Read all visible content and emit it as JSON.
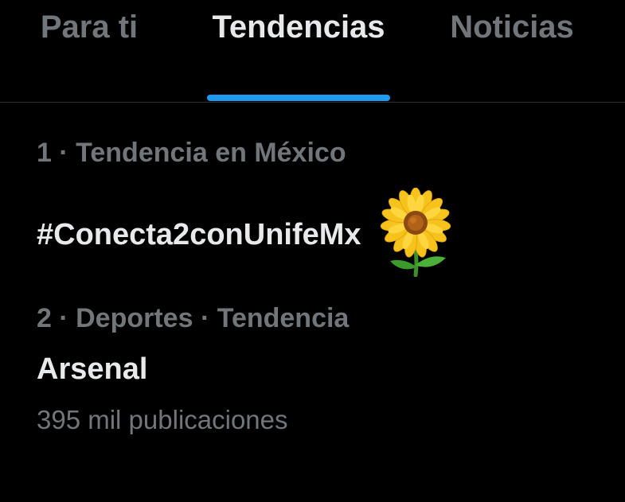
{
  "tabs": [
    {
      "label": "Para ti",
      "active": false
    },
    {
      "label": "Tendencias",
      "active": true
    },
    {
      "label": "Noticias",
      "active": false
    }
  ],
  "colors": {
    "accent": "#1d9bf0",
    "background": "#000000",
    "primary_text": "#e7e9ea",
    "secondary_text": "#71767b",
    "divider": "#2f3336"
  },
  "trends": [
    {
      "meta": "1 · Tendencia en México",
      "title": "#Conecta2conUnifeMx",
      "icon": "sunflower-icon"
    },
    {
      "meta": "2 · Deportes · Tendencia",
      "title": "Arsenal",
      "count": "395 mil publicaciones"
    }
  ]
}
